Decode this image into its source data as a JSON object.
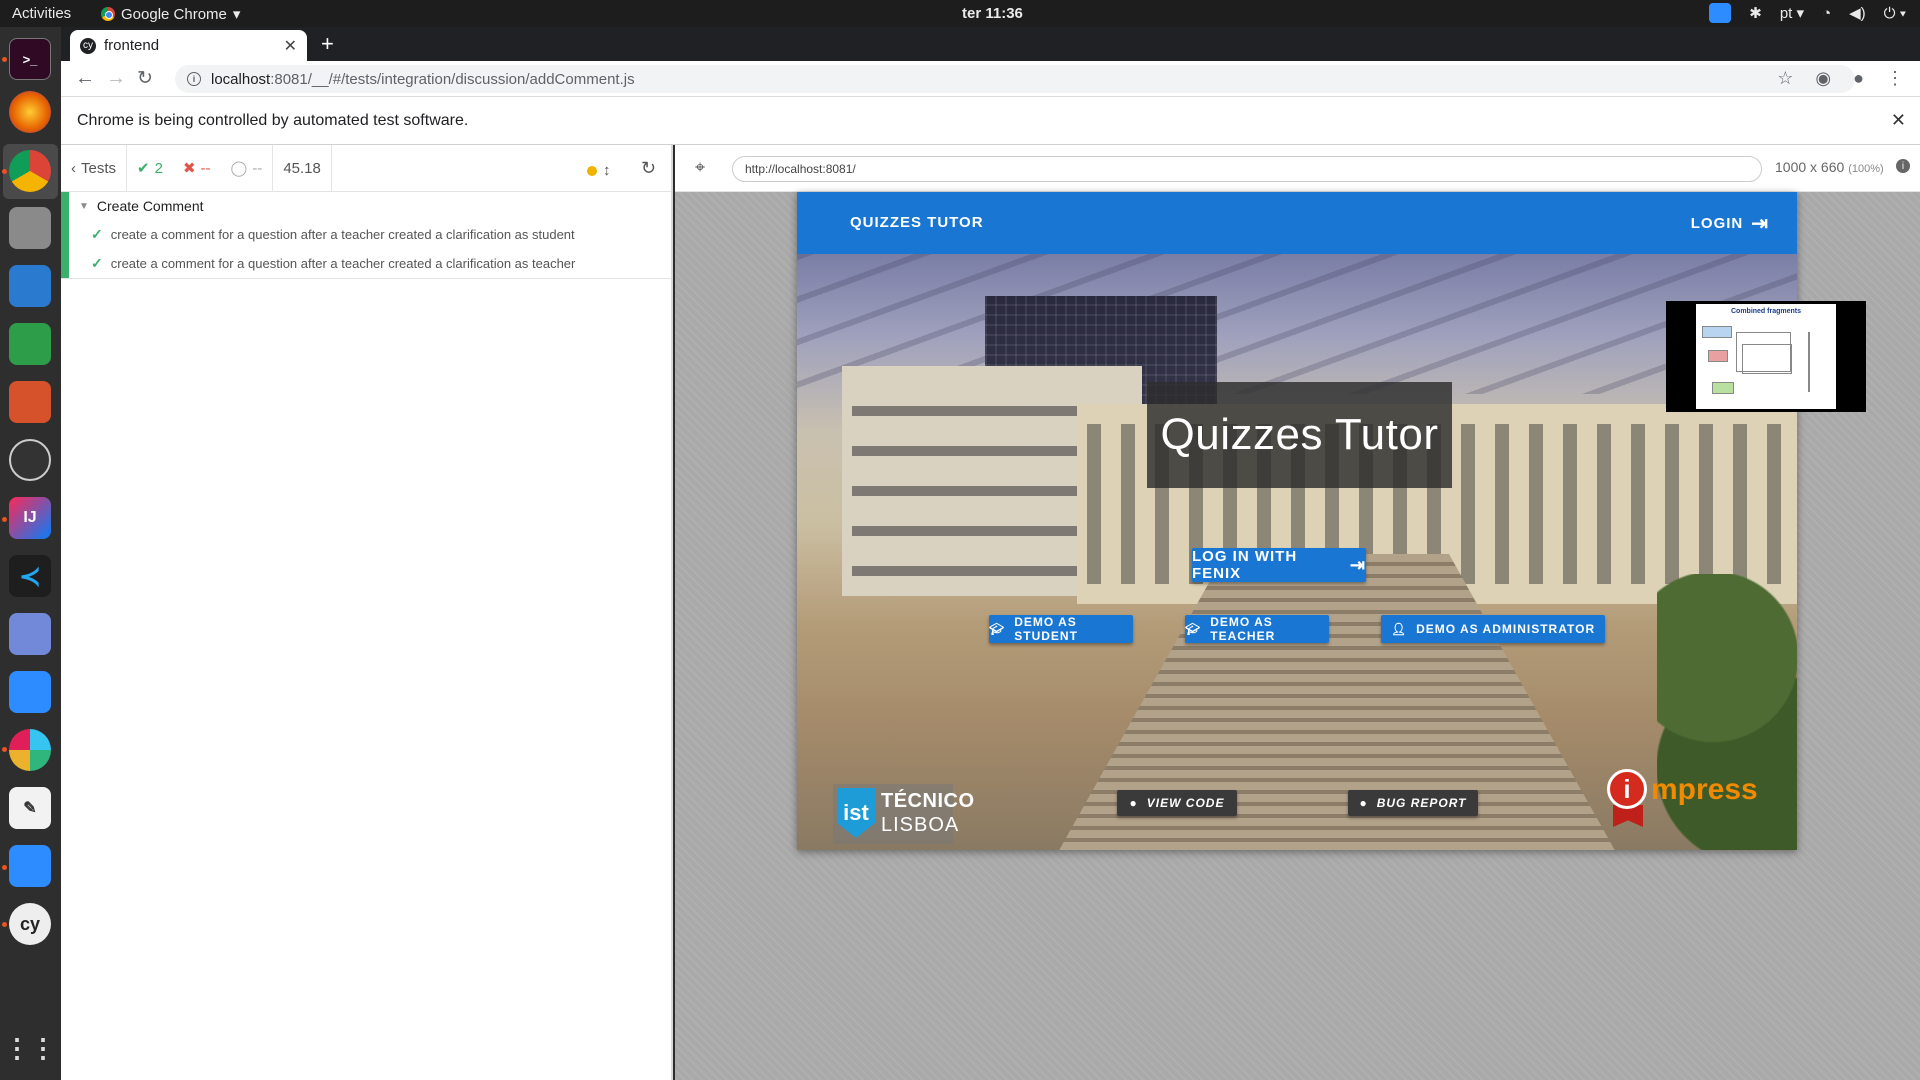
{
  "system": {
    "activities": "Activities",
    "app_menu": "Google Chrome",
    "clock": "ter 11:36",
    "language": "pt"
  },
  "browser": {
    "tab_title": "frontend",
    "url_host": "localhost",
    "url_rest": ":8081/__/#/tests/integration/discussion/addComment.js",
    "infobar": "Chrome is being controlled by automated test software."
  },
  "reporter": {
    "tests_label": "Tests",
    "passed": "2",
    "failed": "--",
    "pending": "--",
    "duration": "45.18",
    "suite": "Create Comment",
    "tests": [
      "create a comment for a question after a teacher created a clarification as student",
      "create a comment for a question after a teacher created a clarification as teacher"
    ]
  },
  "aut": {
    "url": "http://localhost:8081/",
    "size": "1000 x 660",
    "zoom": "(100%)"
  },
  "app": {
    "brand": "QUIZZES TUTOR",
    "login": "LOGIN",
    "hero_title": "Quizzes Tutor",
    "fenix_button": "LOG IN WITH FENIX",
    "demo_student": "DEMO AS STUDENT",
    "demo_teacher": "DEMO AS TEACHER",
    "demo_admin": "DEMO AS ADMINISTRATOR",
    "view_code": "VIEW CODE",
    "bug_report": "BUG REPORT",
    "tecnico_line1": "TÉCNICO",
    "tecnico_line2": "LISBOA",
    "impress": "mpress"
  },
  "thumbnail": {
    "title": "Combined fragments"
  },
  "colors": {
    "primary": "#1976d2",
    "pass": "#3ab06a",
    "fail": "#e0564b"
  }
}
